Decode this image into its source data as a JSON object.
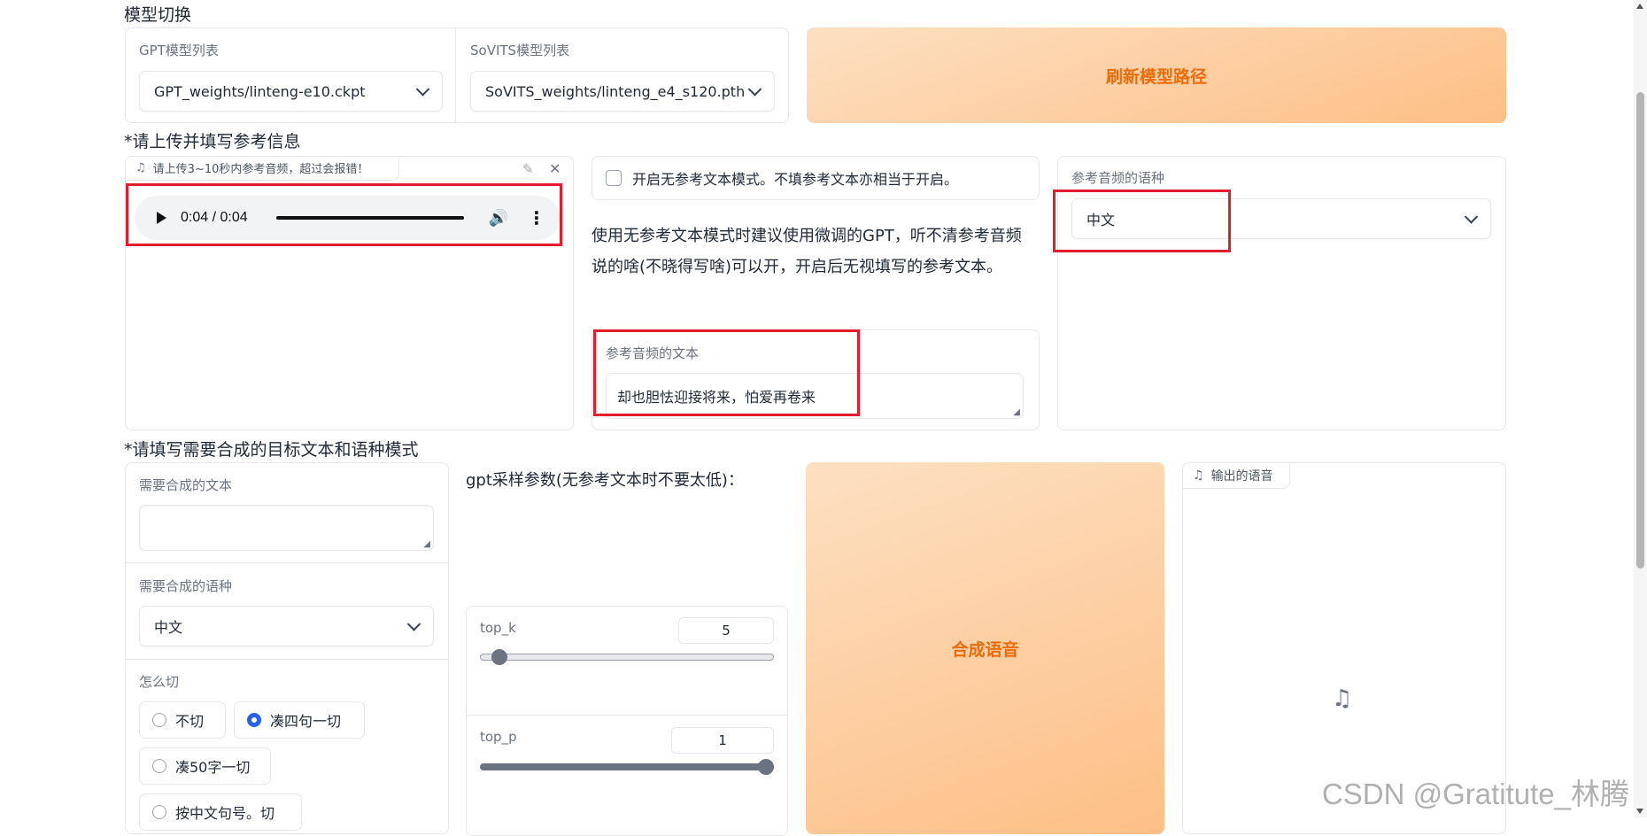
{
  "sections": {
    "model_switch": "模型切换",
    "reference": "*请上传并填写参考信息",
    "target": "*请填写需要合成的目标文本和语种模式"
  },
  "models": {
    "gpt_label": "GPT模型列表",
    "gpt_value": "GPT_weights/linteng-e10.ckpt",
    "sovits_label": "SoVITS模型列表",
    "sovits_value": "SoVITS_weights/linteng_e4_s120.pth",
    "refresh_button": "刷新模型路径"
  },
  "reference": {
    "upload_label": "请上传3~10秒内参考音频，超过会报错！",
    "audio_time": "0:04 / 0:04",
    "audio_progress": 1.0,
    "no_ref_checkbox_label": "开启无参考文本模式。不填参考文本亦相当于开启。",
    "no_ref_checked": false,
    "hint": "使用无参考文本模式时建议使用微调的GPT，听不清参考音频说的啥(不晓得写啥)可以开，开启后无视填写的参考文本。",
    "text_label": "参考音频的文本",
    "text_value": "却也胆怯迎接将来，怕爱再卷来",
    "lang_label": "参考音频的语种",
    "lang_value": "中文"
  },
  "target": {
    "text_label": "需要合成的文本",
    "text_value": "",
    "lang_label": "需要合成的语种",
    "lang_value": "中文",
    "cut_label": "怎么切",
    "cut_options": [
      "不切",
      "凑四句一切",
      "凑50字一切",
      "按中文句号。切"
    ],
    "cut_selected": "凑四句一切",
    "gpt_params_label": "gpt采样参数(无参考文本时不要太低)：",
    "top_k_label": "top_k",
    "top_k_value": "5",
    "top_k_min": 1,
    "top_k_max": 100,
    "top_p_label": "top_p",
    "top_p_value": "1",
    "top_p_min": 0,
    "top_p_max": 1,
    "synth_button": "合成语音",
    "output_label": "输出的语音"
  },
  "watermark": "CSDN @Gratitute_林腾",
  "colors": {
    "accent_orange": "#ea6c0a",
    "annotation_red": "#e11d2e",
    "radio_blue": "#2563eb"
  }
}
